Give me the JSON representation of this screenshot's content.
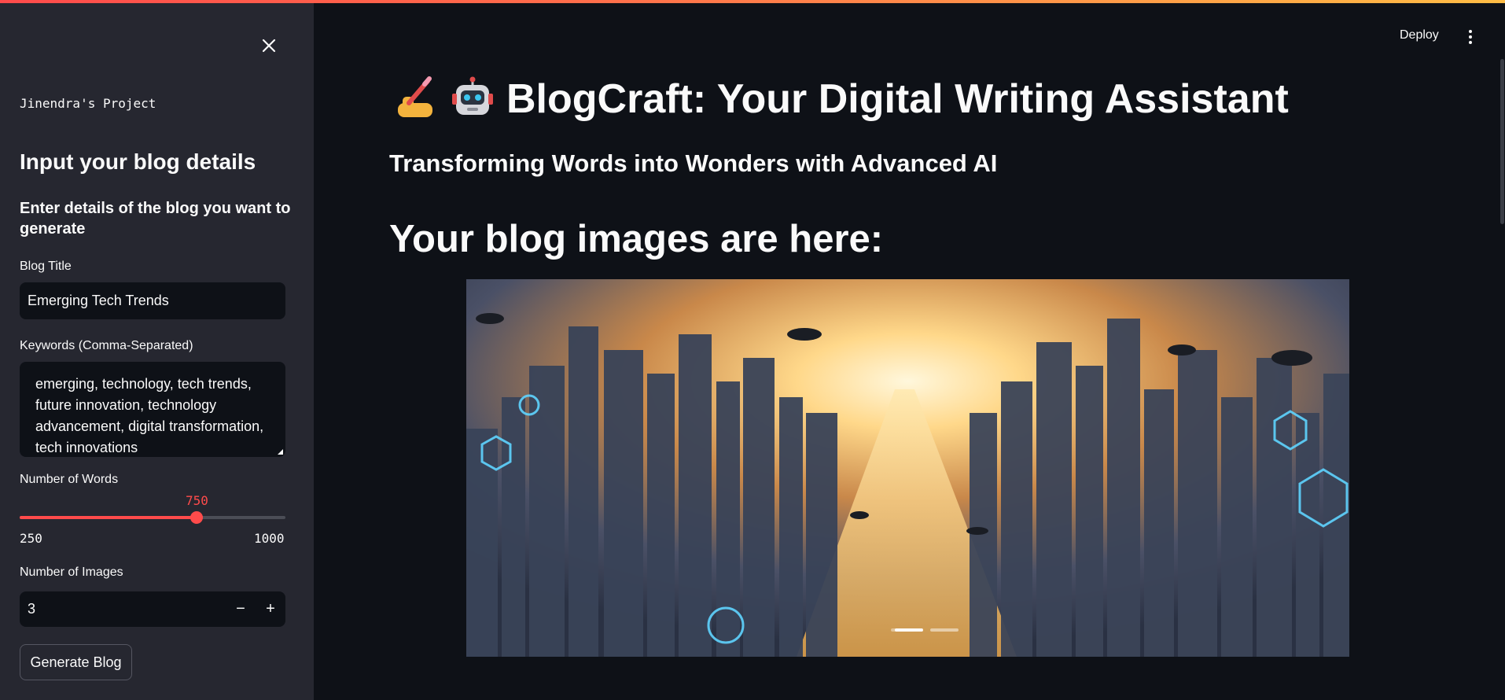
{
  "sidebar": {
    "project_name": "Jinendra's Project",
    "heading": "Input your blog details",
    "subheading": "Enter details of the blog you want to generate",
    "blog_title": {
      "label": "Blog Title",
      "value": "Emerging Tech Trends"
    },
    "keywords": {
      "label": "Keywords (Comma-Separated)",
      "value": "emerging, technology, tech trends, future innovation, technology advancement, digital transformation, tech innovations"
    },
    "words": {
      "label": "Number of Words",
      "value": "750",
      "min": "250",
      "max": "1000"
    },
    "images": {
      "label": "Number of Images",
      "value": "3",
      "minus": "−",
      "plus": "+"
    },
    "generate_label": "Generate Blog"
  },
  "header": {
    "deploy_label": "Deploy"
  },
  "main": {
    "title": "BlogCraft: Your Digital Writing Assistant",
    "subtitle": "Transforming Words into Wonders with Advanced AI",
    "images_heading": "Your blog images are here:"
  },
  "colors": {
    "accent": "#ff4b4b",
    "background": "#0e1117",
    "sidebar": "#262730"
  }
}
